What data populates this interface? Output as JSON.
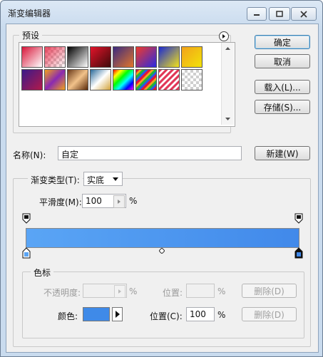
{
  "window": {
    "title": "渐变编辑器"
  },
  "presets": {
    "label": "预设"
  },
  "buttons": {
    "ok": "确定",
    "cancel": "取消",
    "load": "载入(L)...",
    "save": "存储(S)...",
    "new": "新建(W)",
    "delete_opacity": "删除(D)",
    "delete_color": "删除(D)"
  },
  "name_field": {
    "label": "名称(N):",
    "value": "自定"
  },
  "gradient": {
    "type_label": "渐变类型(T):",
    "type_value": "实底",
    "smoothness_label": "平滑度(M):",
    "smoothness_value": "100",
    "smoothness_unit": "%"
  },
  "stops": {
    "label": "色标",
    "opacity_label": "不透明度:",
    "opacity_unit": "%",
    "opacity_location_label": "位置:",
    "opacity_location_unit": "%",
    "color_label": "颜色:",
    "location_label": "位置(C):",
    "location_value": "100",
    "location_unit": "%"
  },
  "colors": {
    "gradient_start": "#5aa5f5",
    "gradient_end": "#4189ea",
    "stop_color": "#3f8ae8"
  }
}
